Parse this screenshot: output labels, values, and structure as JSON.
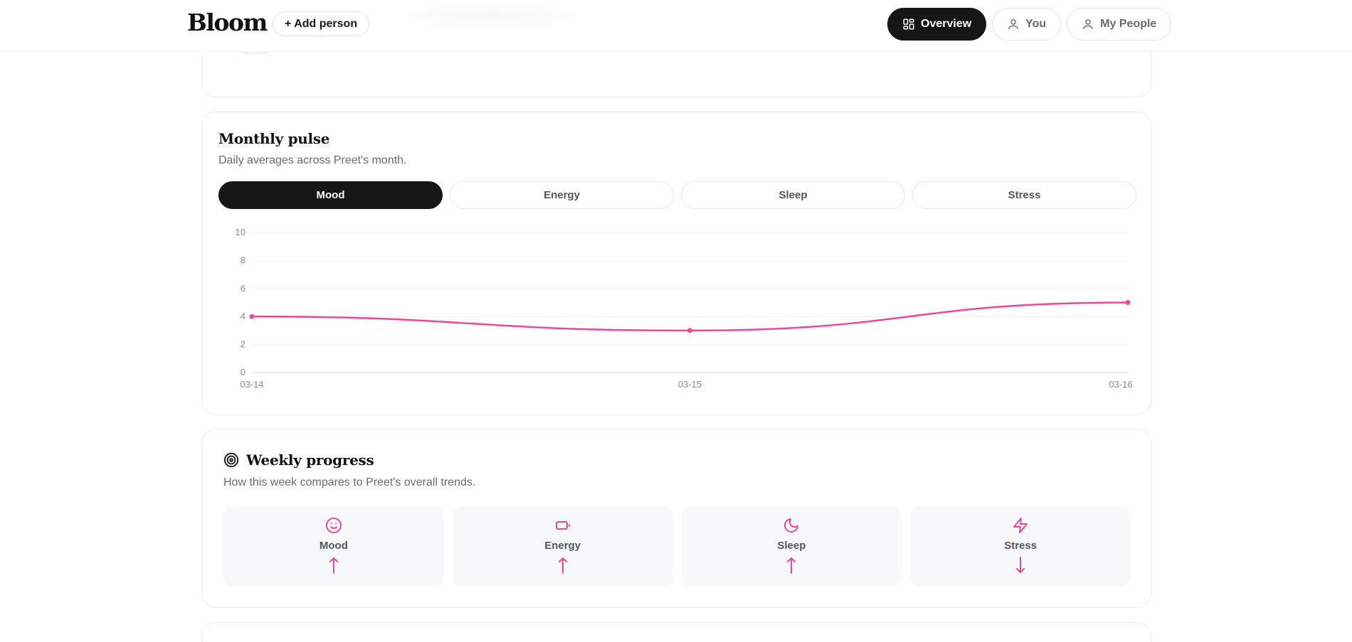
{
  "header": {
    "brand": "Bloom",
    "add_person_label": "+ Add person",
    "nav": [
      {
        "label": "Overview",
        "icon": "grid-icon",
        "active": true
      },
      {
        "label": "You",
        "icon": "user-icon",
        "active": false
      },
      {
        "label": "My People",
        "icon": "user-icon",
        "active": false
      }
    ]
  },
  "pulse": {
    "title": "Monthly pulse",
    "subtitle": "Daily averages across Preet's month.",
    "tabs": [
      {
        "label": "Mood",
        "active": true
      },
      {
        "label": "Energy",
        "active": false
      },
      {
        "label": "Sleep",
        "active": false
      },
      {
        "label": "Stress",
        "active": false
      }
    ]
  },
  "chart_data": {
    "type": "line",
    "x": [
      "03-14",
      "03-15",
      "03-16"
    ],
    "series": [
      {
        "values": [
          4,
          3,
          5
        ],
        "color": "#ec4899"
      }
    ],
    "ylim": [
      0,
      10
    ],
    "yticks": [
      0,
      2,
      4,
      6,
      8,
      10
    ],
    "grid": true,
    "title": "",
    "xlabel": "",
    "ylabel": ""
  },
  "weekly": {
    "title": "Weekly progress",
    "subtitle": "How this week compares to Preet's overall trends.",
    "tiles": [
      {
        "label": "Mood",
        "icon": "smile-icon",
        "trend": "up"
      },
      {
        "label": "Energy",
        "icon": "battery-icon",
        "trend": "up"
      },
      {
        "label": "Sleep",
        "icon": "moon-icon",
        "trend": "up"
      },
      {
        "label": "Stress",
        "icon": "zap-icon",
        "trend": "down"
      }
    ]
  },
  "colors": {
    "accent": "#ec4899",
    "dark": "#161616"
  }
}
